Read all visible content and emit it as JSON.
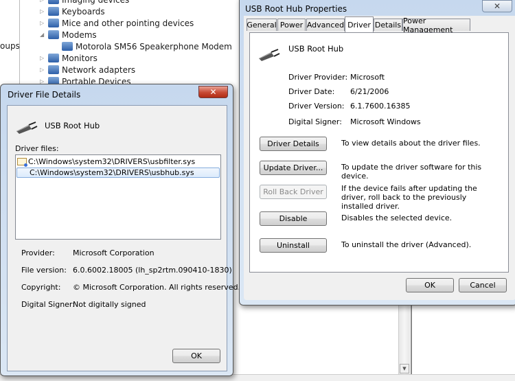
{
  "background": {
    "left_text": "oups",
    "tree": [
      {
        "label": "Imaging devices",
        "expander": "collapsed"
      },
      {
        "label": "Keyboards",
        "expander": "collapsed"
      },
      {
        "label": "Mice and other pointing devices",
        "expander": "collapsed"
      },
      {
        "label": "Modems",
        "expander": "expanded"
      },
      {
        "label": "Motorola SM56 Speakerphone Modem",
        "expander": "none"
      },
      {
        "label": "Monitors",
        "expander": "collapsed"
      },
      {
        "label": "Network adapters",
        "expander": "collapsed"
      },
      {
        "label": "Portable Devices",
        "expander": "collapsed"
      }
    ]
  },
  "file_details": {
    "title": "Driver File Details",
    "device_name": "USB Root Hub",
    "files_label": "Driver files:",
    "files": [
      {
        "path": "C:\\Windows\\system32\\DRIVERS\\usbfilter.sys",
        "selected": false,
        "icon": "certificate-icon"
      },
      {
        "path": "C:\\Windows\\system32\\DRIVERS\\usbhub.sys",
        "selected": true
      }
    ],
    "info": [
      {
        "label": "Provider:",
        "value": "Microsoft Corporation"
      },
      {
        "label": "File version:",
        "value": "6.0.6002.18005 (lh_sp2rtm.090410-1830)"
      },
      {
        "label": "Copyright:",
        "value": "© Microsoft Corporation. All rights reserved."
      },
      {
        "label": "Digital Signer:",
        "value": "Not digitally signed"
      }
    ],
    "ok": "OK",
    "close": "✕"
  },
  "properties": {
    "title": "USB Root Hub Properties",
    "close": "✕",
    "tabs": [
      "General",
      "Power",
      "Advanced",
      "Driver",
      "Details",
      "Power Management"
    ],
    "active_tab": "Driver",
    "device_name": "USB Root Hub",
    "info": [
      {
        "label": "Driver Provider:",
        "value": "Microsoft"
      },
      {
        "label": "Driver Date:",
        "value": "6/21/2006"
      },
      {
        "label": "Driver Version:",
        "value": "6.1.7600.16385"
      },
      {
        "label": "Digital Signer:",
        "value": "Microsoft Windows"
      }
    ],
    "actions": [
      {
        "label": "Driver Details",
        "desc": "To view details about the driver files.",
        "enabled": true
      },
      {
        "label": "Update Driver...",
        "desc": "To update the driver software for this device.",
        "enabled": true
      },
      {
        "label": "Roll Back Driver",
        "desc": "If the device fails after updating the driver, roll back to the previously installed driver.",
        "enabled": false
      },
      {
        "label": "Disable",
        "desc": "Disables the selected device.",
        "enabled": true
      },
      {
        "label": "Uninstall",
        "desc": "To uninstall the driver (Advanced).",
        "enabled": true
      }
    ],
    "ok": "OK",
    "cancel": "Cancel"
  }
}
